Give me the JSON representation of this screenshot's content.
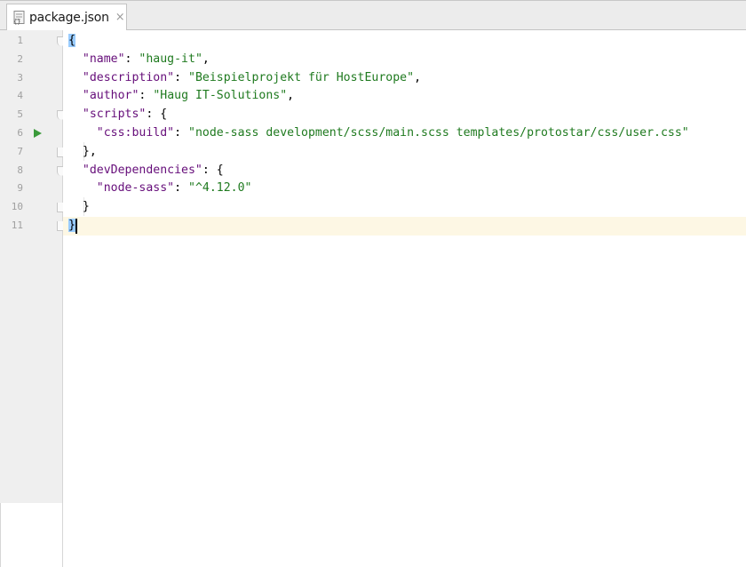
{
  "tab": {
    "filename": "package.json",
    "close_glyph": "×",
    "icon": "json-file-icon"
  },
  "line_numbers": [
    "1",
    "2",
    "3",
    "4",
    "5",
    "6",
    "7",
    "8",
    "9",
    "10",
    "11"
  ],
  "run_icon": "run-gutter-icon",
  "code": {
    "line1": {
      "open": "{"
    },
    "line2": {
      "key": "\"name\"",
      "sep": ": ",
      "value": "\"haug-it\"",
      "end": ","
    },
    "line3": {
      "key": "\"description\"",
      "sep": ": ",
      "value": "\"Beispielprojekt für HostEurope\"",
      "end": ","
    },
    "line4": {
      "key": "\"author\"",
      "sep": ": ",
      "value": "\"Haug IT-Solutions\"",
      "end": ","
    },
    "line5": {
      "key": "\"scripts\"",
      "sep": ": ",
      "end": "{"
    },
    "line6": {
      "key": "\"css:build\"",
      "sep": ": ",
      "value": "\"node-sass development/scss/main.scss templates/protostar/css/user.css\""
    },
    "line7": {
      "end": "},"
    },
    "line8": {
      "key": "\"devDependencies\"",
      "sep": ": ",
      "end": "{"
    },
    "line9": {
      "key": "\"node-sass\"",
      "sep": ": ",
      "value": "\"^4.12.0\""
    },
    "line10": {
      "end": "}"
    },
    "line11": {
      "close": "}"
    }
  },
  "colors": {
    "key": "#660e7a",
    "string": "#1f7a1f",
    "caret_line": "#fdf7e4",
    "brace_highlight": "#99ccff"
  }
}
